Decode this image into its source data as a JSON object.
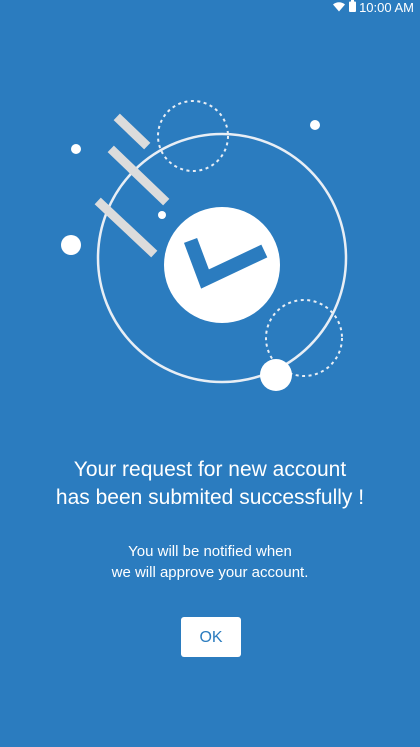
{
  "status_bar": {
    "time": "10:00 AM",
    "wifi_icon": "wifi-icon",
    "battery_icon": "battery-icon"
  },
  "illustration": {
    "center_icon": "checkmark-icon",
    "accent_color": "#2b7cbf",
    "background_color": "#2b7cbf"
  },
  "message": {
    "headline_line1": "Your request for new account",
    "headline_line2": "has been submited successfully !",
    "subtext_line1": "You will be notified when",
    "subtext_line2": "we will approve your account."
  },
  "actions": {
    "ok_label": "OK"
  }
}
